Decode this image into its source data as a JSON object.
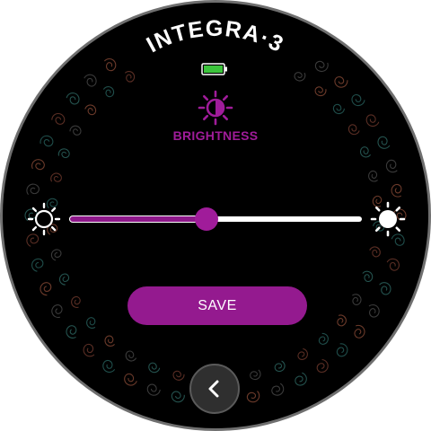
{
  "app": {
    "brand": "INTEGRA·3"
  },
  "status": {
    "battery_icon": "battery-icon",
    "battery_color": "#3cc43c"
  },
  "setting": {
    "icon": "brightness-icon",
    "label": "BRIGHTNESS",
    "accent_color": "#a01c9a"
  },
  "slider": {
    "min_icon": "sun-low-icon",
    "max_icon": "sun-high-icon",
    "value_fraction": 0.47
  },
  "actions": {
    "save_label": "SAVE",
    "back_icon": "chevron-left-icon"
  }
}
